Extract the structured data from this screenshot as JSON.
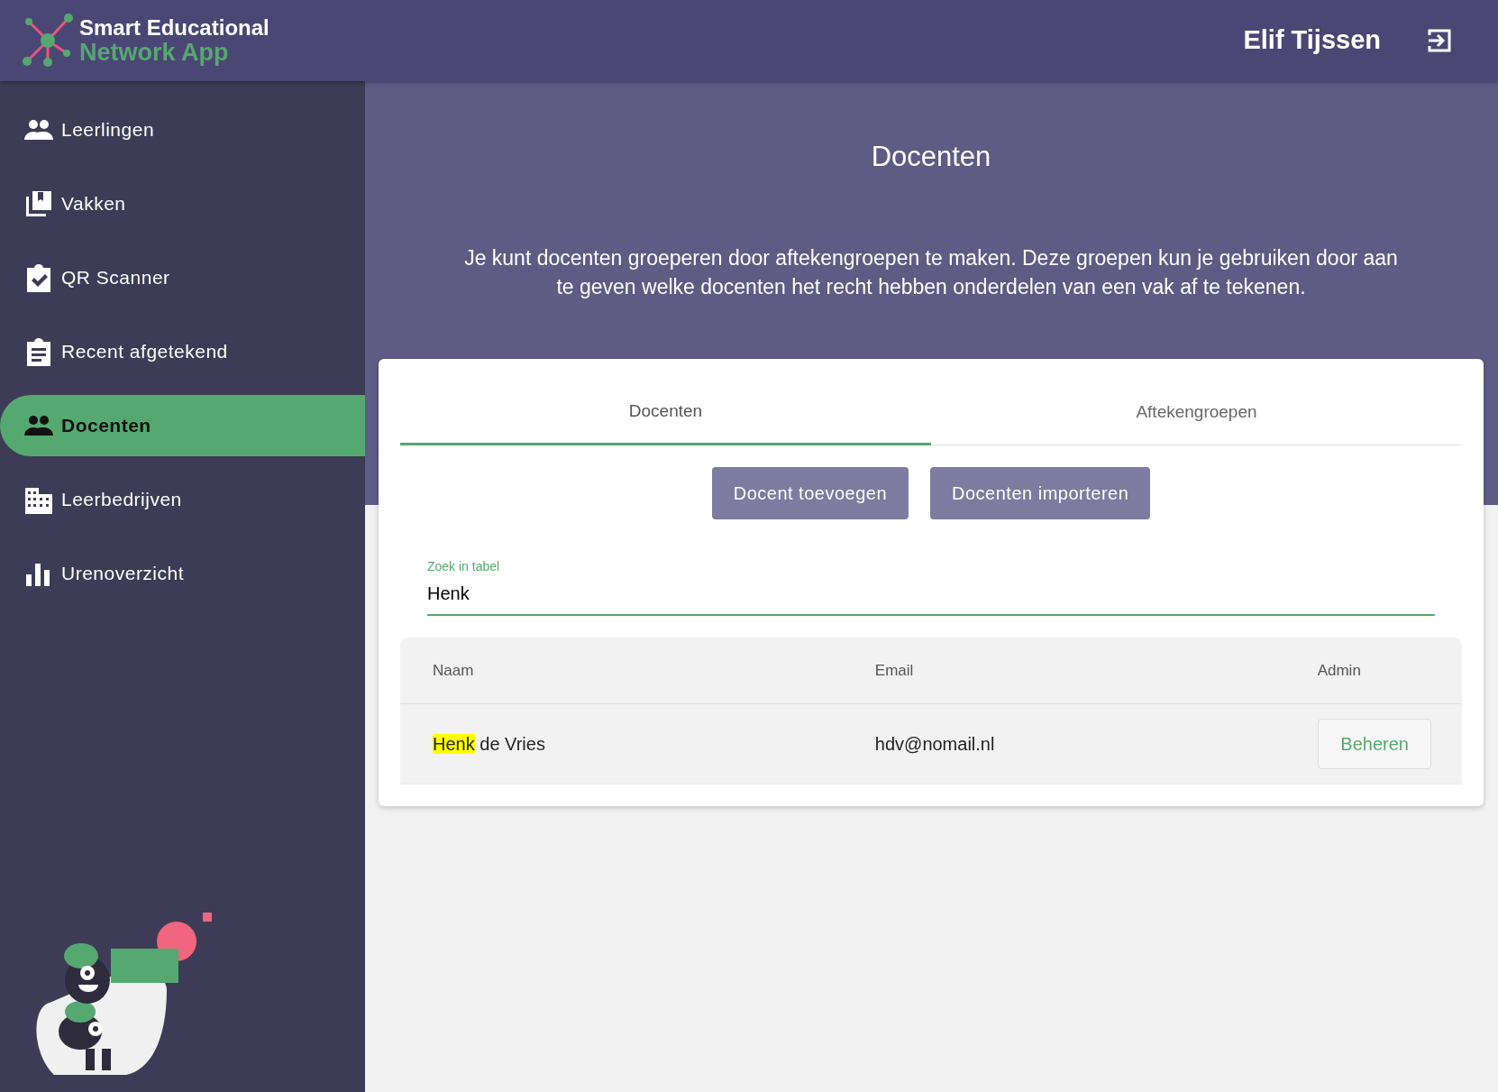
{
  "app": {
    "logo_line1": "Smart Educational",
    "logo_line2": "Network App",
    "user": "Elif Tijssen"
  },
  "sidebar": {
    "items": [
      {
        "label": "Leerlingen",
        "selected": false
      },
      {
        "label": "Vakken",
        "selected": false
      },
      {
        "label": "QR Scanner",
        "selected": false
      },
      {
        "label": "Recent afgetekend",
        "selected": false
      },
      {
        "label": "Docenten",
        "selected": true
      },
      {
        "label": "Leerbedrijven",
        "selected": false
      },
      {
        "label": "Urenoverzicht",
        "selected": false
      }
    ]
  },
  "page": {
    "title": "Docenten",
    "intro": "Je kunt docenten groeperen door aftekengroepen te maken. Deze groepen kun je gebruiken door aan te geven welke docenten het recht hebben onderdelen van een vak af te tekenen."
  },
  "tabs": [
    {
      "label": "Docenten",
      "selected": true
    },
    {
      "label": "Aftekengroepen",
      "selected": false
    }
  ],
  "buttons": [
    "Docent toevoegen",
    "Docenten importeren"
  ],
  "search": {
    "label": "Zoek in tabel",
    "value": "Henk"
  },
  "table": {
    "columns": [
      "Naam",
      "Email",
      "Admin"
    ],
    "rows": [
      {
        "name_match": "Henk",
        "name_rest": "de Vries",
        "email": "hdv@nomail.nl",
        "action": "Beheren"
      }
    ]
  }
}
